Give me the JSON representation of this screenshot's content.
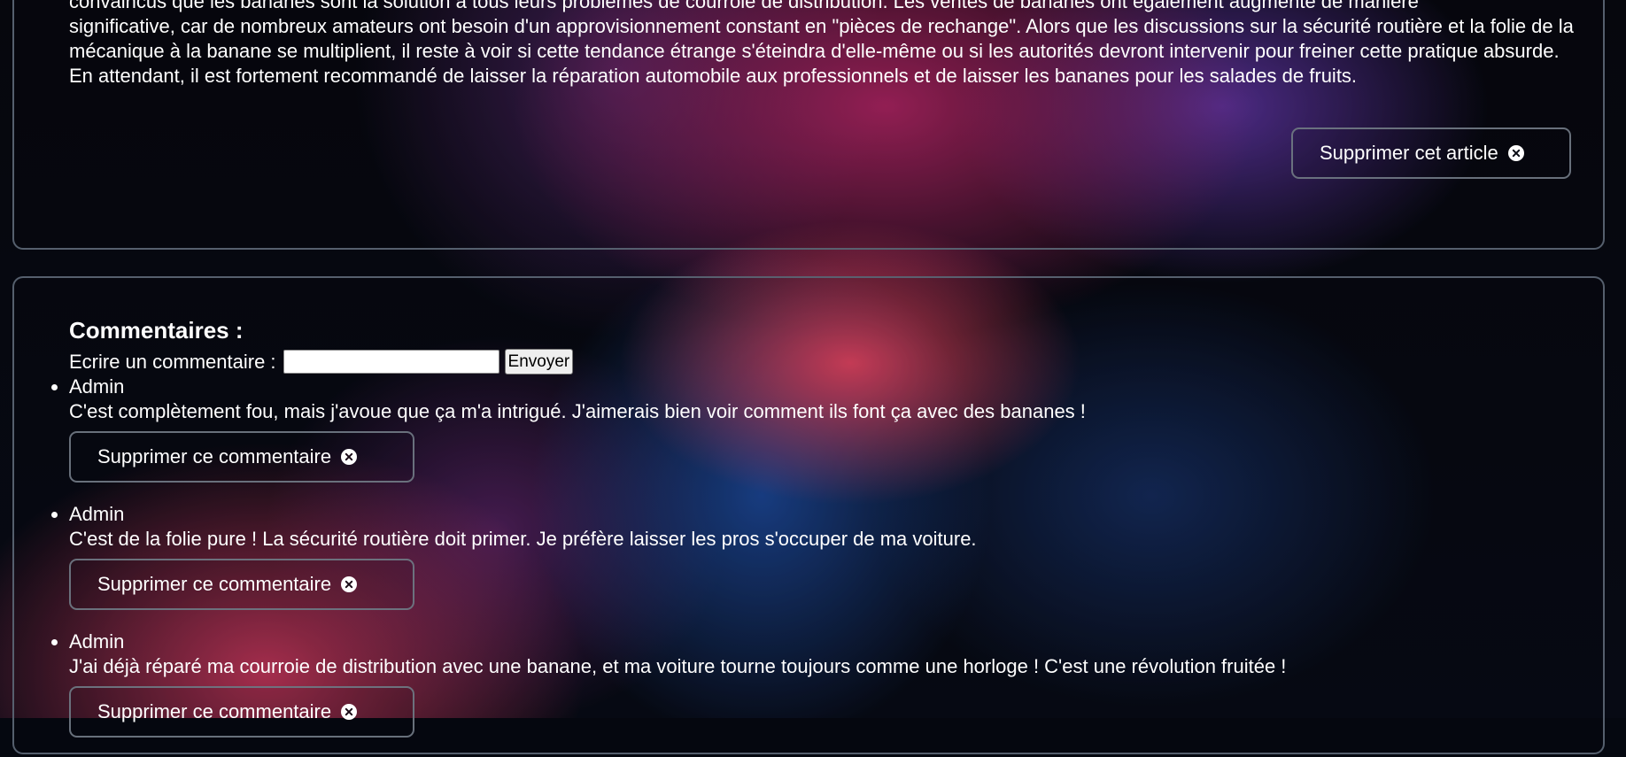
{
  "article": {
    "text_first_line": "convaincus que les bananes sont la solution à tous leurs problèmes de courroie de distribution. Les ventes de bananes ont également augmenté de manière",
    "text": "significative, car de nombreux amateurs ont besoin d'un approvisionnement constant en \"pièces de rechange\". Alors que les discussions sur la sécurité routière et la folie de la mécanique à la banane se multiplient, il reste à voir si cette tendance étrange s'éteindra d'elle-même ou si les autorités devront intervenir pour freiner cette pratique absurde. En attendant, il est fortement recommandé de laisser la réparation automobile aux professionnels et de laisser les bananes pour les salades de fruits.",
    "delete_label": "Supprimer cet article",
    "delete_icon": "circle-x-icon"
  },
  "comments": {
    "title": "Commentaires :",
    "form_label": "Ecrire un commentaire :",
    "input_value": "",
    "submit_label": "Envoyer",
    "items": [
      {
        "author": "Admin",
        "text": "C'est complètement fou, mais j'avoue que ça m'a intrigué. J'aimerais bien voir comment ils font ça avec des bananes !",
        "delete_label": "Supprimer ce commentaire"
      },
      {
        "author": "Admin",
        "text": "C'est de la folie pure ! La sécurité routière doit primer. Je préfère laisser les pros s'occuper de ma voiture.",
        "delete_label": "Supprimer ce commentaire"
      },
      {
        "author": "Admin",
        "text": "J'ai déjà réparé ma courroie de distribution avec une banane, et ma voiture tourne toujours comme une horloge ! C'est une révolution fruitée !",
        "delete_label": "Supprimer ce commentaire"
      }
    ]
  }
}
